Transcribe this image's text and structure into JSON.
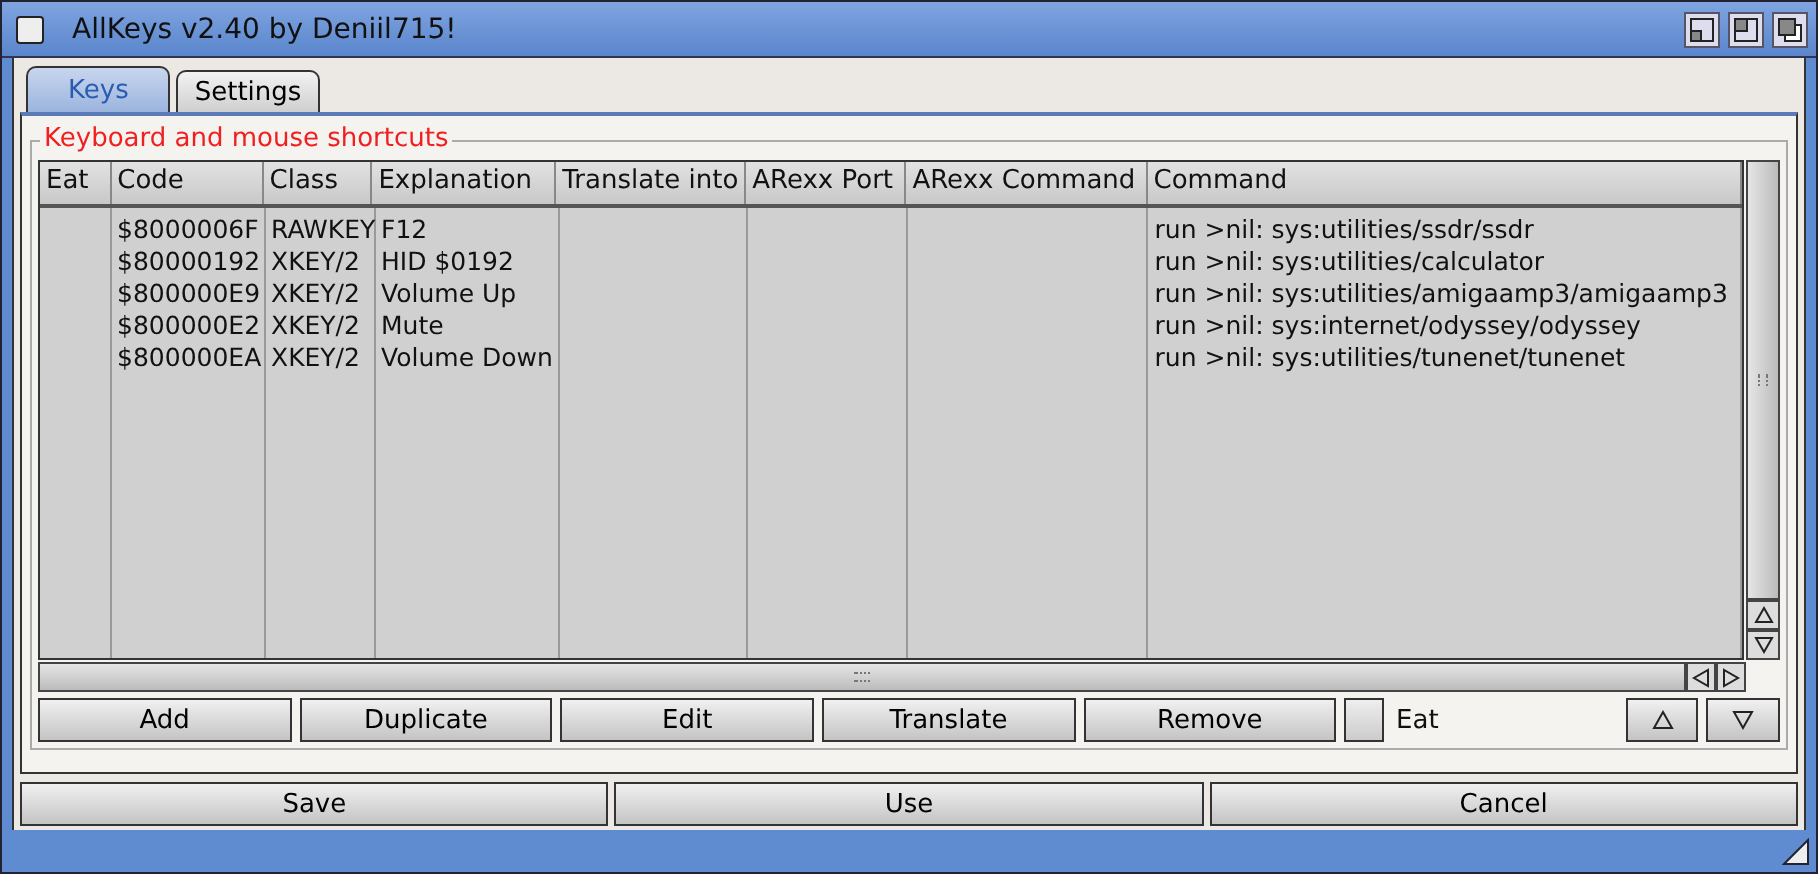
{
  "window": {
    "title": "AllKeys v2.40 by Deniil715!"
  },
  "tabs": [
    {
      "label": "Keys",
      "selected": true
    },
    {
      "label": "Settings",
      "selected": false
    }
  ],
  "group": {
    "title": "Keyboard and mouse shortcuts"
  },
  "table": {
    "columns": [
      "Eat",
      "Code",
      "Class",
      "Explanation",
      "Translate into",
      "ARexx Port",
      "ARexx Command",
      "Command"
    ],
    "rows": [
      {
        "code": "$8000006F",
        "class": "RAWKEY",
        "explanation": "F12",
        "command": "run >nil: sys:utilities/ssdr/ssdr"
      },
      {
        "code": "$80000192",
        "class": "XKEY/2",
        "explanation": "HID $0192",
        "command": "run >nil: sys:utilities/calculator"
      },
      {
        "code": "$800000E9",
        "class": "XKEY/2",
        "explanation": "Volume Up",
        "command": "run >nil: sys:utilities/amigaamp3/amigaamp3"
      },
      {
        "code": "$800000E2",
        "class": "XKEY/2",
        "explanation": "Mute",
        "command": "run >nil: sys:internet/odyssey/odyssey"
      },
      {
        "code": "$800000EA",
        "class": "XKEY/2",
        "explanation": "Volume Down",
        "command": "run >nil: sys:utilities/tunenet/tunenet"
      }
    ]
  },
  "list_buttons": [
    "Add",
    "Duplicate",
    "Edit",
    "Translate",
    "Remove"
  ],
  "eat_checkbox": {
    "label": "Eat",
    "checked": false
  },
  "bottom_buttons": [
    "Save",
    "Use",
    "Cancel"
  ]
}
